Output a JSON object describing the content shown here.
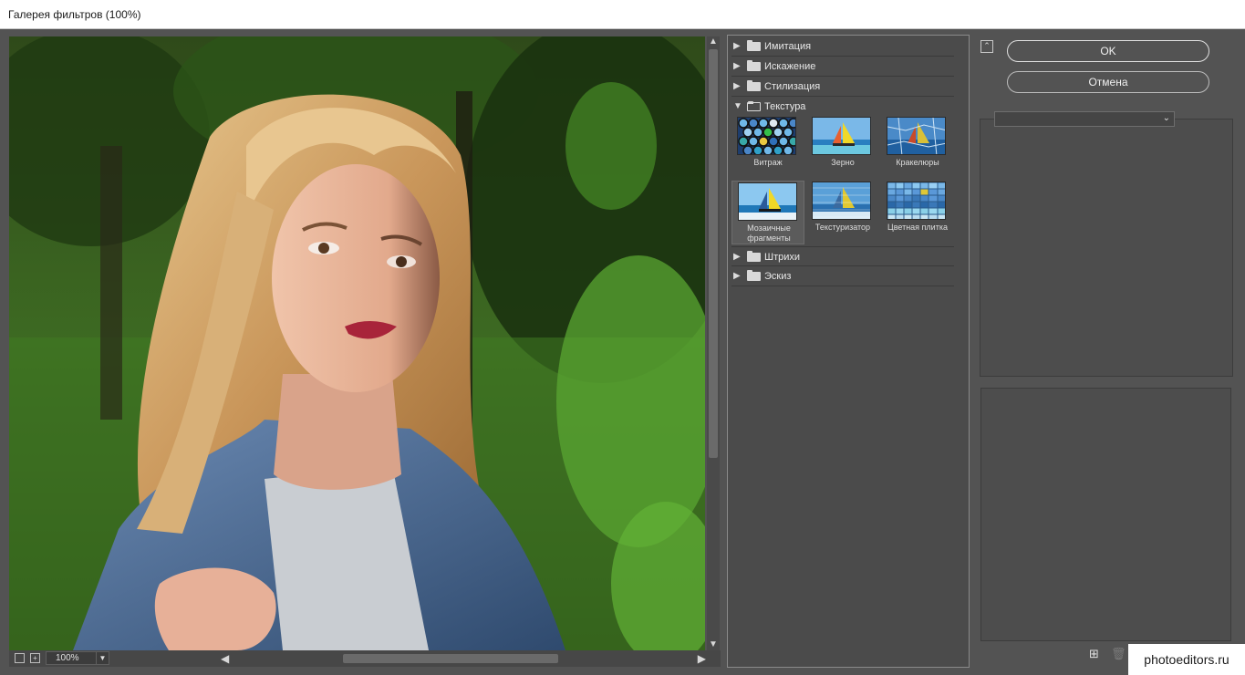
{
  "window": {
    "title": "Галерея фильтров (100%)"
  },
  "preview": {
    "zoom": "100%"
  },
  "filters": {
    "categories_top": [
      {
        "label": "Имитация",
        "expanded": false
      },
      {
        "label": "Искажение",
        "expanded": false
      },
      {
        "label": "Стилизация",
        "expanded": false
      },
      {
        "label": "Текстура",
        "expanded": true
      }
    ],
    "texture_items": [
      {
        "label": "Витраж"
      },
      {
        "label": "Зерно"
      },
      {
        "label": "Кракелюры"
      },
      {
        "label": "Мозаичные фрагменты",
        "selected": true
      },
      {
        "label": "Текстуризатор"
      },
      {
        "label": "Цветная плитка"
      }
    ],
    "categories_bottom": [
      {
        "label": "Штрихи",
        "expanded": false
      },
      {
        "label": "Эскиз",
        "expanded": false
      }
    ]
  },
  "actions": {
    "ok_label": "OK",
    "cancel_label": "Отмена"
  },
  "filter_select": {
    "value": ""
  },
  "watermark": {
    "text": "photoeditors.ru"
  },
  "colors": {
    "panel_bg": "#535353",
    "dark_panel": "#4b4b4b",
    "accent_border": "#e0e0e0"
  }
}
